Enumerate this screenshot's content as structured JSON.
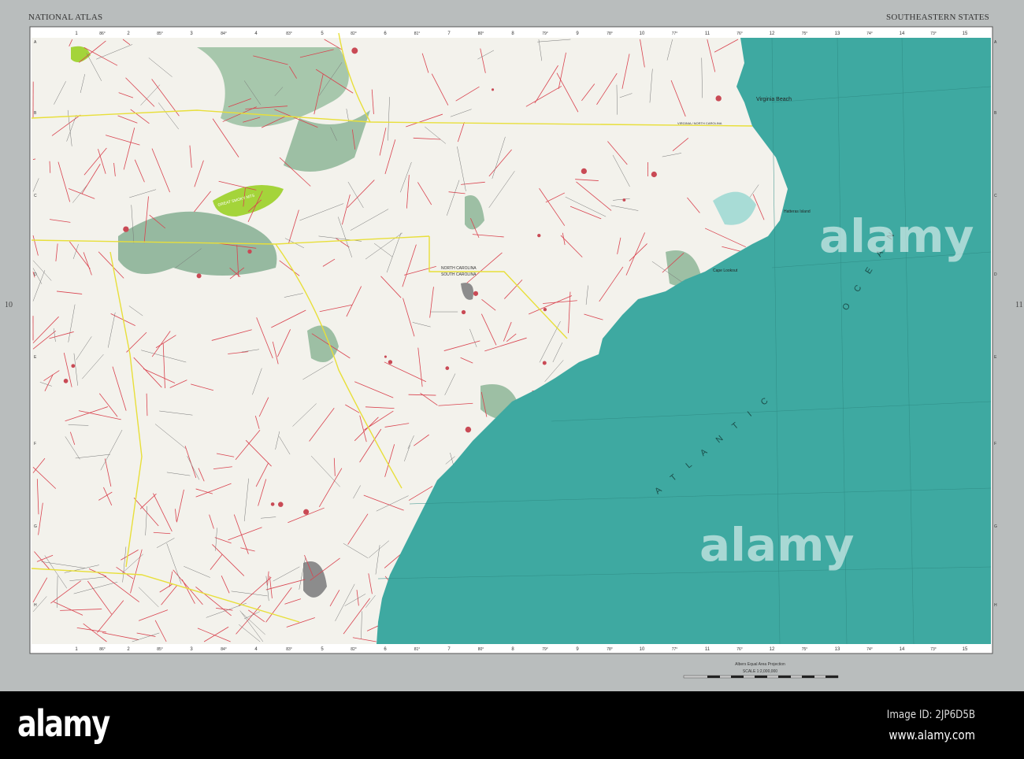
{
  "header": {
    "left": "NATIONAL ATLAS",
    "right": "SOUTHEASTERN STATES"
  },
  "page_numbers": {
    "left": "10",
    "right": "11"
  },
  "grid": {
    "columns": [
      "1",
      "2",
      "3",
      "4",
      "5",
      "6",
      "7",
      "8",
      "9",
      "10",
      "11",
      "12",
      "13",
      "14",
      "15"
    ],
    "longitudes": [
      "86°",
      "85°",
      "84°",
      "83°",
      "82°",
      "81°",
      "80°",
      "79°",
      "78°",
      "77°",
      "76°",
      "75°",
      "74°",
      "73°"
    ],
    "rows": [
      "A",
      "B",
      "C",
      "D",
      "E",
      "F",
      "G",
      "H"
    ]
  },
  "labels": {
    "virginia_beach": "Virginia Beach",
    "va_nc": "VIRGINIA / NORTH CAROLINA",
    "nc": "NORTH CAROLINA",
    "sc": "SOUTH CAROLINA",
    "smoky": "GREAT SMOKY MTS",
    "hatteras": "Hatteras Island",
    "cape_lookout": "Cape Lookout",
    "atlantic": "A T L A N T I C",
    "ocean": "O C E A N"
  },
  "scale": {
    "projection": "Albers Equal Area Projection",
    "scale": "SCALE 1:2,000,000"
  },
  "watermark": {
    "text": "alamy",
    "image_id": "Image ID: 2JP6D5B",
    "url": "www.alamy.com"
  },
  "colors": {
    "ocean": "#3ea9a1",
    "land": "#f3f2ec",
    "border": "#b9bdbd",
    "roads": "#d9434f",
    "state_line": "#e8df3a",
    "forest": "#8fb59a",
    "park": "#a4d43a"
  }
}
